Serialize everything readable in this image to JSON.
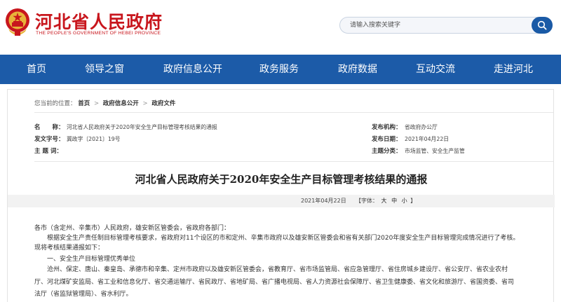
{
  "header": {
    "site_title": "河北省人民政府",
    "site_subtitle": "THE PEOPLE'S GOVERNMENT OF HEBEI PROVINCE",
    "search_placeholder": "请输入搜索关键字",
    "emblem_icon": "national-emblem-icon",
    "search_icon": "search-icon",
    "brand_color": "#c8161d"
  },
  "nav": {
    "color": "#1c5ba8",
    "items": [
      "首页",
      "领导之窗",
      "政府信息公开",
      "政务服务",
      "政府数据",
      "互动交流",
      "走进河北"
    ]
  },
  "breadcrumb": {
    "prefix": "您当前的位置：",
    "items": [
      "首页",
      "政府信息公开",
      "政府文件"
    ],
    "separator": ">"
  },
  "meta": {
    "name_label": "名　　称：",
    "name_value": "河北省人民政府关于2020年安全生产目标管理考核结果的通报",
    "doc_no_label": "发文字号：",
    "doc_no_value": "冀政字〔2021〕19号",
    "topic_label": "主 题 词：",
    "topic_value": "",
    "org_label": "发布机构：",
    "org_value": "省政府办公厅",
    "date_label": "发布日期：",
    "date_value": "2021年04月22日",
    "category_label": "主题分类：",
    "category_value": "市场监管、安全生产监管"
  },
  "article": {
    "title": "河北省人民政府关于2020年安全生产目标管理考核结果的通报",
    "date": "2021年04月22日",
    "font_size_prefix": "【字体：",
    "font_sizes": [
      "大",
      "中",
      "小"
    ],
    "font_size_suffix": "】",
    "paragraphs": [
      "各市（含定州、辛集市）人民政府，雄安新区管委会，省政府各部门：",
      "　　根据安全生产责任制目标管理考核要求，省政府对11个设区的市和定州、辛集市政府以及雄安新区管委会和省有关部门2020年度安全生产目标管理完成情况进行了考核。",
      "现将考核结果通报如下：",
      "　　一、安全生产目标管理优秀单位",
      "　　沧州、保定、唐山、秦皇岛、承德市和辛集、定州市政府以及雄安新区管委会，省教育厅、省市场监管局、省应急管理厅、省住房城乡建设厅、省公安厅、省农业农村",
      "厅、河北煤矿安监局、省工业和信息化厅、省交通运输厅、省民政厅、省地矿局、省广播电视局、省人力资源社会保障厅、省卫生健康委、省文化和旅游厅、省国资委、省司",
      "法厅（省监狱管理局）、省水利厅。"
    ]
  }
}
